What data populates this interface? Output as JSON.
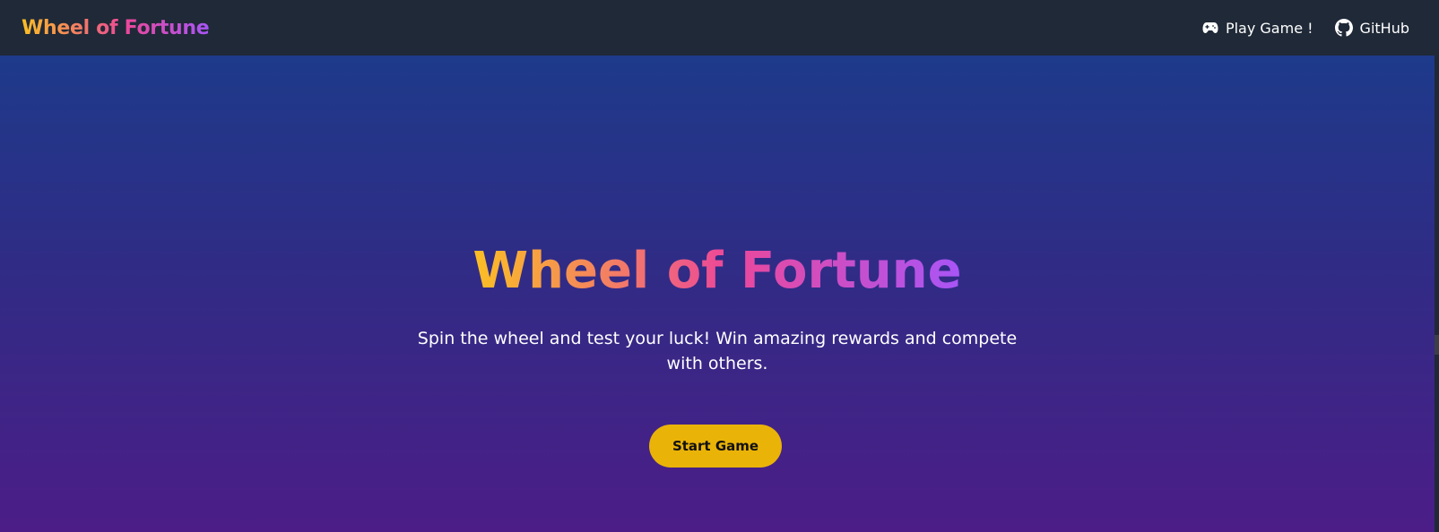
{
  "navbar": {
    "brand": "Wheel of Fortune",
    "links": [
      {
        "label": "Play Game !",
        "icon": "gamepad-icon"
      },
      {
        "label": "GitHub",
        "icon": "github-icon"
      }
    ]
  },
  "hero": {
    "title": "Wheel of Fortune",
    "subtitle": "Spin the wheel and test your luck! Win amazing rewards and compete with others.",
    "cta_label": "Start Game"
  },
  "colors": {
    "navbar_bg": "#1f2937",
    "hero_gradient_top": "#1e3a8a",
    "hero_gradient_bottom": "#4c1d87",
    "title_gradient": [
      "#fbbf24",
      "#ec4899",
      "#a855f7"
    ],
    "cta_bg": "#eab308"
  }
}
